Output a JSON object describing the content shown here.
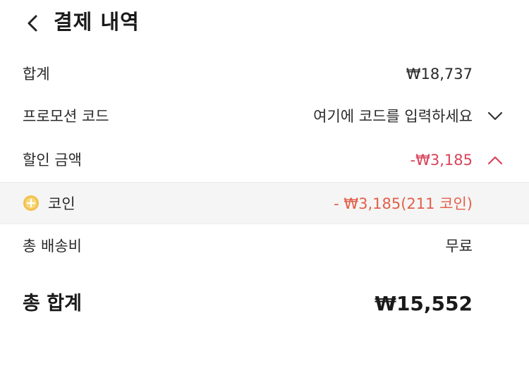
{
  "header": {
    "title": "결제 내역",
    "back_icon": "chevron-left-icon"
  },
  "summary": {
    "subtotal": {
      "label": "합계",
      "value": "₩18,737"
    },
    "promo": {
      "label": "프로모션 코드",
      "placeholder": "여기에 코드를 입력하세요",
      "icon": "chevron-down-icon"
    },
    "discount": {
      "label": "할인 금액",
      "value": "-₩3,185",
      "icon": "chevron-up-icon",
      "expanded": true
    },
    "coin": {
      "label": "코인",
      "value": "- ₩3,185(211 코인)",
      "icon": "coin-icon"
    },
    "shipping": {
      "label": "총 배송비",
      "value": "무료"
    },
    "total": {
      "label": "총 합계",
      "value": "₩15,552"
    }
  },
  "colors": {
    "discount": "#d9435a",
    "coin_value": "#e2604a",
    "coin_row_bg": "#f5f5f5",
    "coin_gold": "#f2c14e"
  }
}
